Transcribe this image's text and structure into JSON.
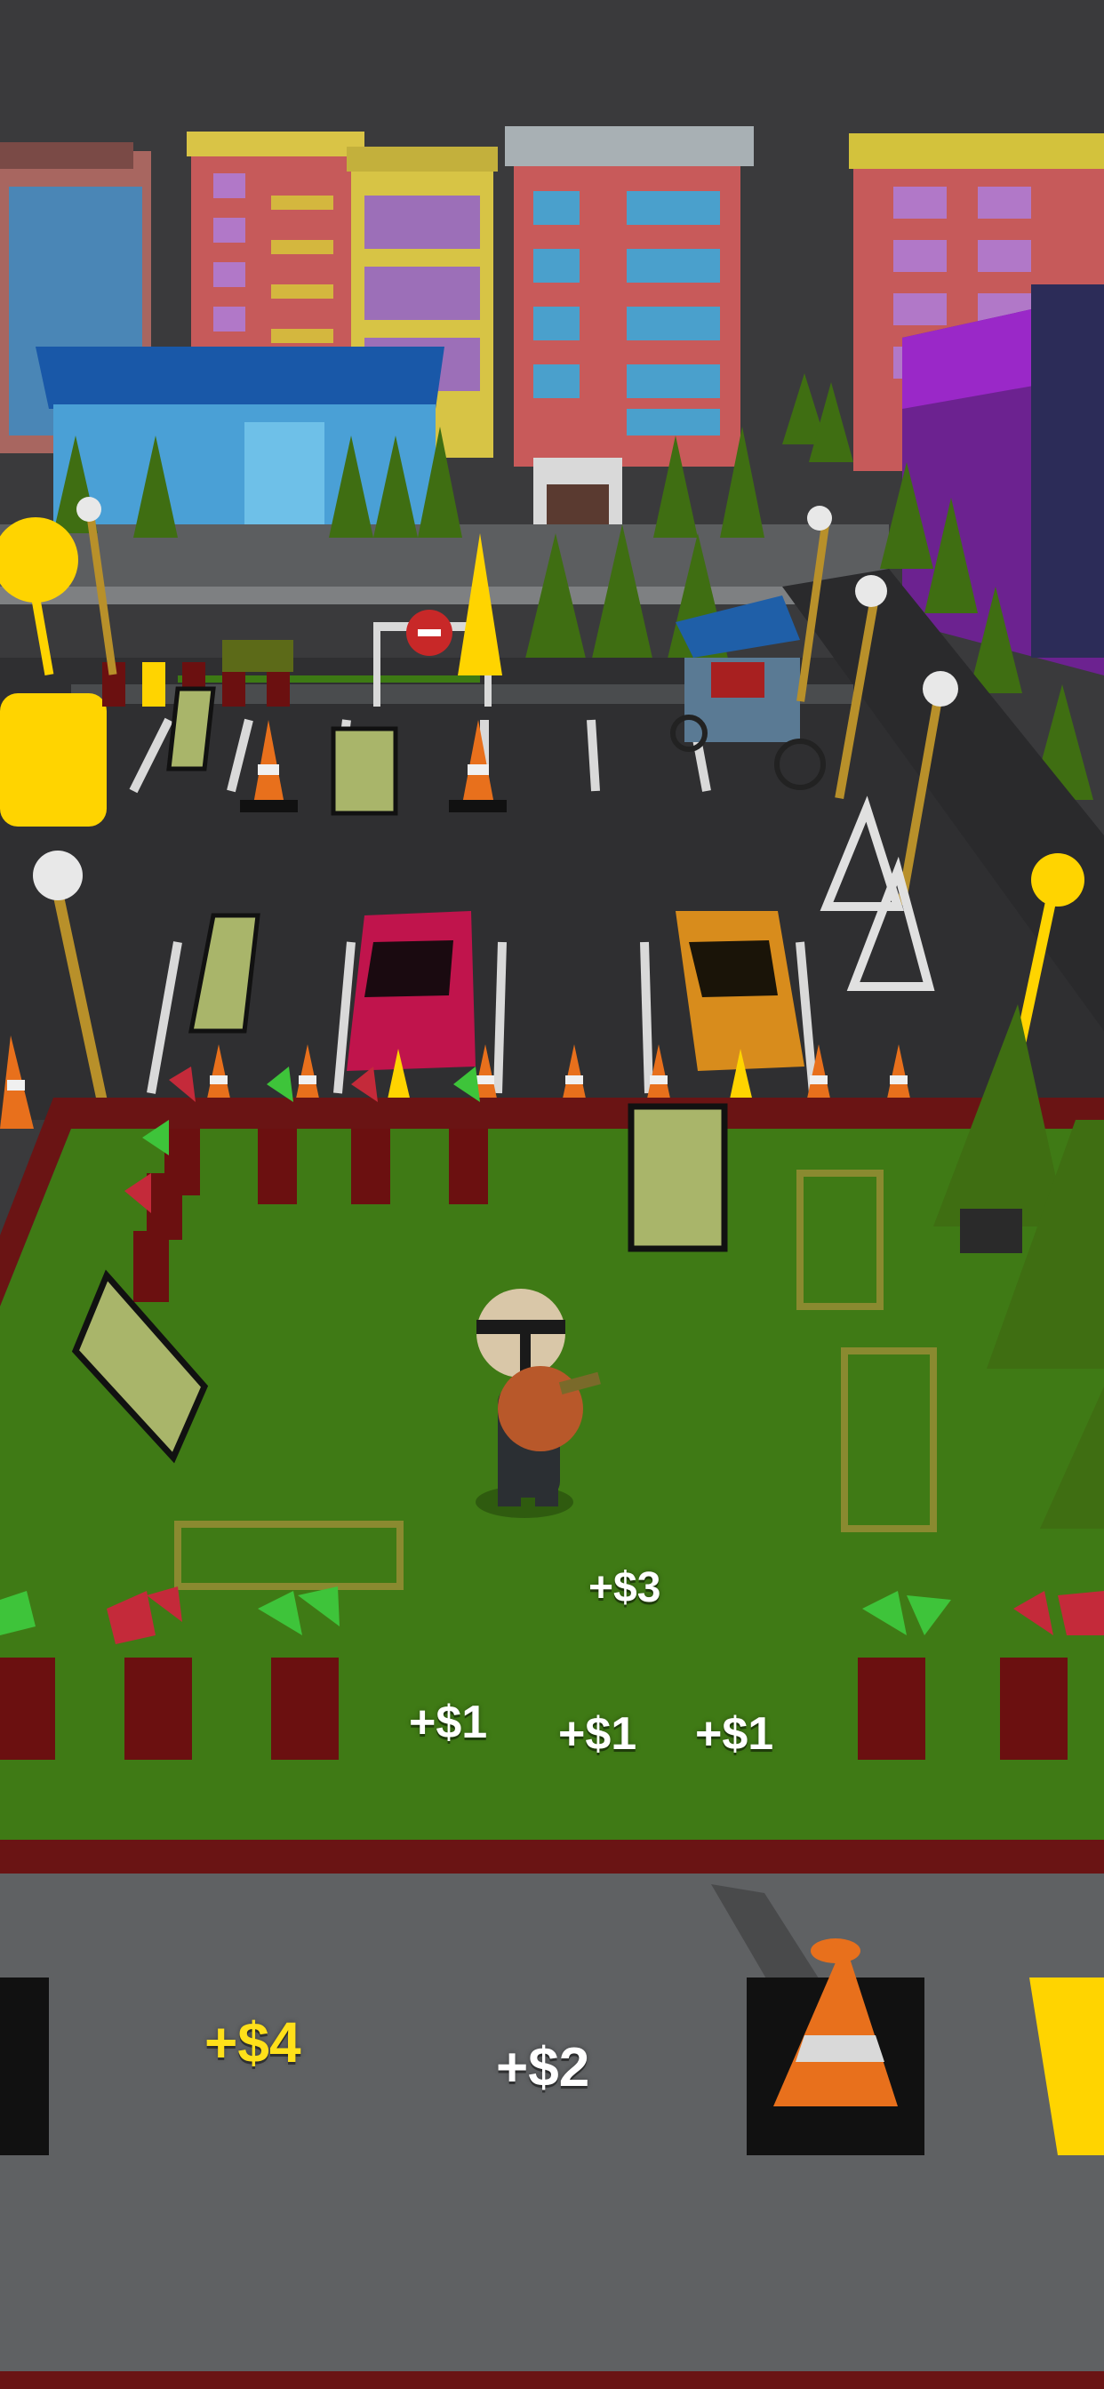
{
  "game": {
    "rewards": [
      {
        "text": "+$3",
        "color": "white"
      },
      {
        "text": "+$1",
        "color": "white"
      },
      {
        "text": "+$1",
        "color": "white"
      },
      {
        "text": "+$1",
        "color": "white"
      },
      {
        "text": "+$4",
        "color": "yellow"
      },
      {
        "text": "+$2",
        "color": "white"
      }
    ]
  },
  "colors": {
    "sky": "#3a3a3c",
    "grass": "#3f7a15",
    "asphalt": "#2f2f31",
    "road": "#5f6163",
    "curb": "#6a1414",
    "cone_orange": "#e8701c",
    "highlight_yellow": "#ffd400",
    "tree_green": "#3f6e12",
    "pot_red": "#6b1010"
  }
}
